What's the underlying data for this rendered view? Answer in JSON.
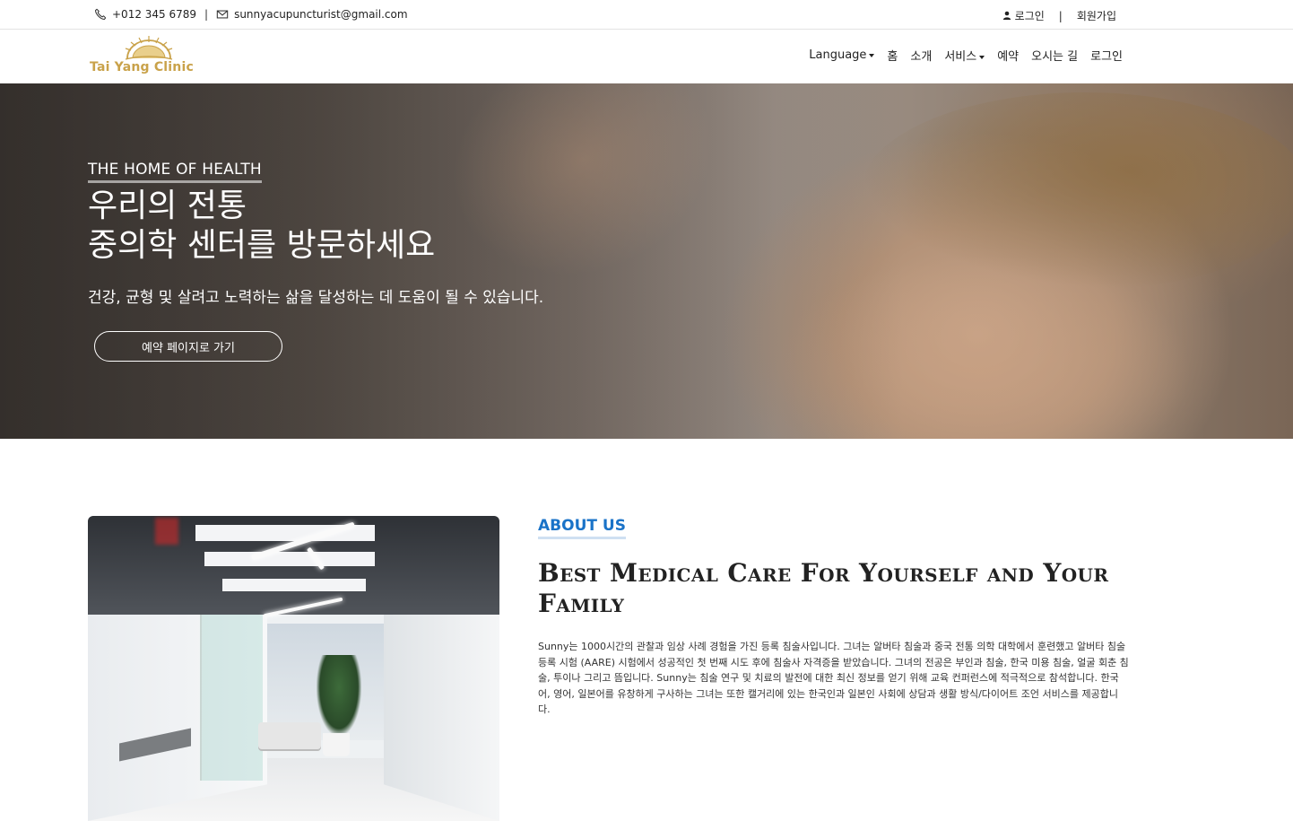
{
  "topbar": {
    "phone": "+012 345 6789",
    "separator": "|",
    "email": "sunnyacupuncturist@gmail.com",
    "login": "로그인",
    "auth_separator": "|",
    "signup": "회원가입"
  },
  "navbar": {
    "logo_text": "Tai Yang Clinic",
    "items": [
      {
        "label": "Language",
        "dropdown": true
      },
      {
        "label": "홈"
      },
      {
        "label": "소개"
      },
      {
        "label": "서비스",
        "dropdown": true
      },
      {
        "label": "예약"
      },
      {
        "label": "오시는 길"
      },
      {
        "label": "로그인"
      }
    ]
  },
  "hero": {
    "eyebrow": "THE HOME OF HEALTH",
    "title_line1": "우리의 전통",
    "title_line2": "중의학 센터를 방문하세요",
    "subtitle": "건강, 균형 및 살려고 노력하는 삶을 달성하는 데 도움이 될 수 있습니다.",
    "button": "예약 페이지로 가기"
  },
  "about": {
    "eyebrow": "ABOUT US",
    "title": "Best Medical Care For Yourself and Your Family",
    "text": "Sunny는 1000시간의 관찰과 임상 사례 경험을 가진 등록 침술사입니다. 그녀는 알버타 침술과 중국 전통 의학 대학에서 훈련했고 알버타 침술 등록 시험 (AARE) 시험에서 성공적인 첫 번째 시도 후에 침술사 자격증을 받았습니다. 그녀의 전공은 부인과 침술, 한국 미용 침술, 얼굴 회춘 침술, 투이나 그리고 뜸입니다. Sunny는 침술 연구 및 치료의 발전에 대한 최신 정보를 얻기 위해 교육 컨퍼런스에 적극적으로 참석합니다. 한국어, 영어, 일본어를 유창하게 구사하는 그녀는 또한 캘거리에 있는 한국인과 일본인 사회에 상담과 생활 방식/다이어트 조언 서비스를 제공합니다."
  },
  "colors": {
    "accent_blue": "#1a73c8",
    "logo_gold": "#c9a24a"
  },
  "icons": [
    "phone-icon",
    "email-icon",
    "user-icon",
    "caret-down-icon"
  ]
}
